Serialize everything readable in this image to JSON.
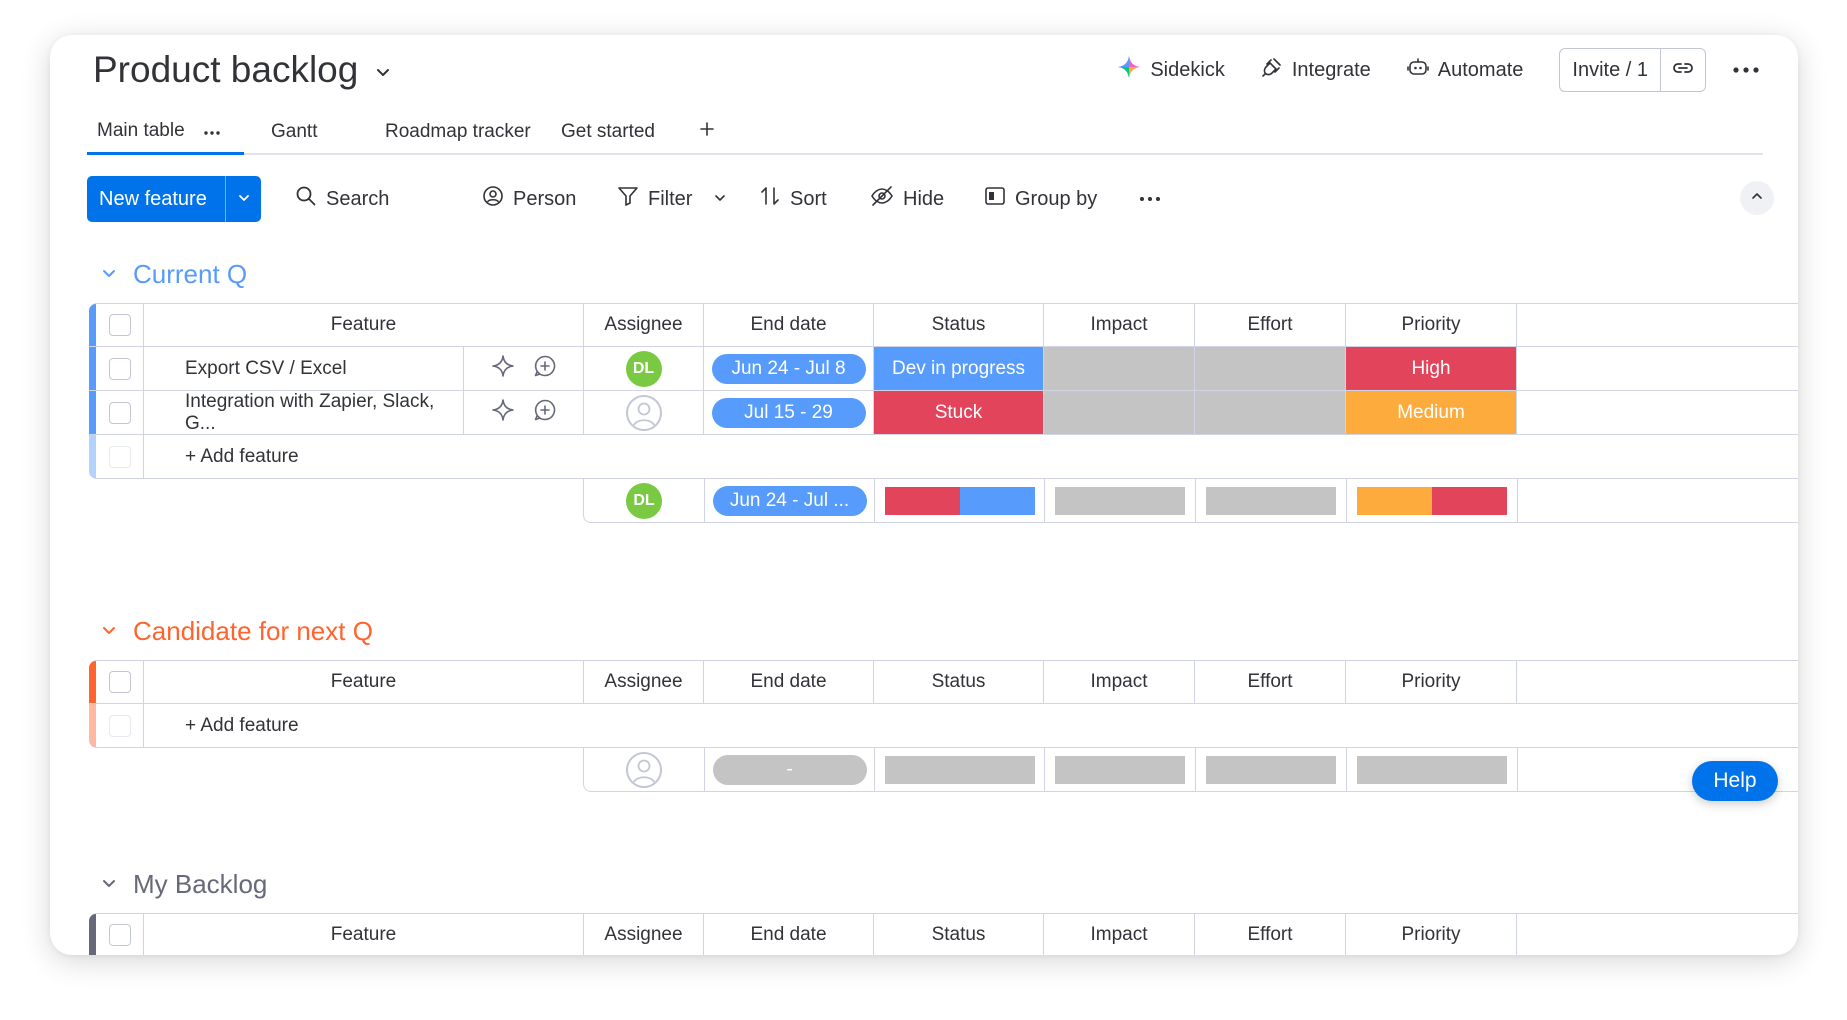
{
  "board": {
    "title": "Product backlog"
  },
  "top_actions": {
    "sidekick": "Sidekick",
    "integrate": "Integrate",
    "automate": "Automate",
    "invite": "Invite / 1"
  },
  "tabs": [
    {
      "label": "Main table",
      "active": true
    },
    {
      "label": "Gantt"
    },
    {
      "label": "Roadmap tracker"
    },
    {
      "label": "Get started"
    }
  ],
  "toolbar": {
    "new_feature": "New feature",
    "search": "Search",
    "person": "Person",
    "filter": "Filter",
    "sort": "Sort",
    "hide": "Hide",
    "group_by": "Group by"
  },
  "columns": [
    "Feature",
    "Assignee",
    "End date",
    "Status",
    "Impact",
    "Effort",
    "Priority"
  ],
  "colors": {
    "blue": "#579bfc",
    "red": "#e2445c",
    "orange": "#fdab3d",
    "gray": "#c4c4c4",
    "group_current": "#579bfc",
    "group_candidate": "#ff642e",
    "group_backlog": "#676879",
    "accent": "#0073ea"
  },
  "groups": [
    {
      "name": "Current Q",
      "rows": [
        {
          "feature": "Export CSV / Excel",
          "assignee": "DL",
          "end_date": "Jun 24 - Jul 8",
          "status": "Dev in progress",
          "priority": "High"
        },
        {
          "feature": "Integration with Zapier, Slack, G...",
          "assignee": "",
          "end_date": "Jul 15 - 29",
          "status": "Stuck",
          "priority": "Medium"
        }
      ],
      "add_label": "+ Add feature",
      "summary": {
        "assignee": "DL",
        "end_date": "Jun 24 - Jul ..."
      }
    },
    {
      "name": "Candidate for next Q",
      "rows": [],
      "add_label": "+ Add feature",
      "summary": {
        "end_date": "-"
      }
    },
    {
      "name": "My Backlog",
      "rows": []
    }
  ],
  "help": "Help"
}
